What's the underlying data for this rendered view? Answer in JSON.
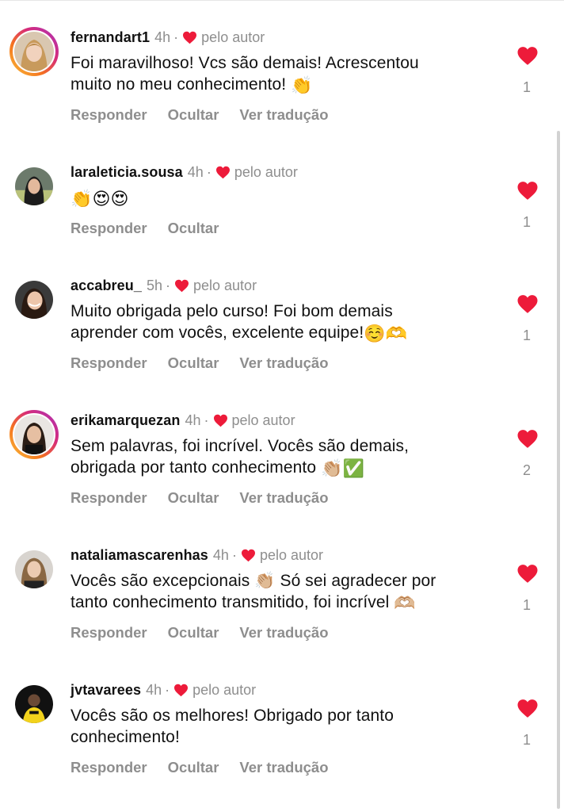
{
  "colors": {
    "heart": "#ed1b3a",
    "muted": "#8e8e8e",
    "text": "#111111"
  },
  "author_like_label": "pelo autor",
  "actions": {
    "reply": "Responder",
    "hide": "Ocultar",
    "translate": "Ver tradução"
  },
  "comments": [
    {
      "username": "fernandart1",
      "time": "4h",
      "text": "Foi maravilhoso! Vcs são demais! Acrescentou\nmuito no meu conhecimento! ",
      "emoji": "👏",
      "likes": "1",
      "story_ring": true,
      "has_translate": true
    },
    {
      "username": "laraleticia.sousa",
      "time": "4h",
      "text": "",
      "emoji": "👏😍😍",
      "likes": "1",
      "story_ring": false,
      "has_translate": false
    },
    {
      "username": "accabreu_",
      "time": "5h",
      "text": "Muito obrigada pelo curso! Foi bom demais\naprender com vocês, excelente equipe!",
      "emoji": "☺️🫶",
      "likes": "1",
      "story_ring": false,
      "has_translate": true
    },
    {
      "username": "erikamarquezan",
      "time": "4h",
      "text": "Sem palavras, foi incrível. Vocês são demais,\nobrigada por tanto conhecimento ",
      "emoji": "👏🏼✅",
      "likes": "2",
      "story_ring": true,
      "has_translate": true
    },
    {
      "username": "nataliamascarenhas",
      "time": "4h",
      "text": "Vocês são excepcionais 👏🏼 Só sei agradecer por\ntanto conhecimento transmitido, foi incrível ",
      "emoji": "🫶🏼",
      "likes": "1",
      "story_ring": false,
      "has_translate": true
    },
    {
      "username": "jvtavarees",
      "time": "4h",
      "text": "Vocês são os melhores! Obrigado por tanto\nconhecimento!",
      "emoji": "",
      "likes": "1",
      "story_ring": false,
      "has_translate": true
    }
  ]
}
